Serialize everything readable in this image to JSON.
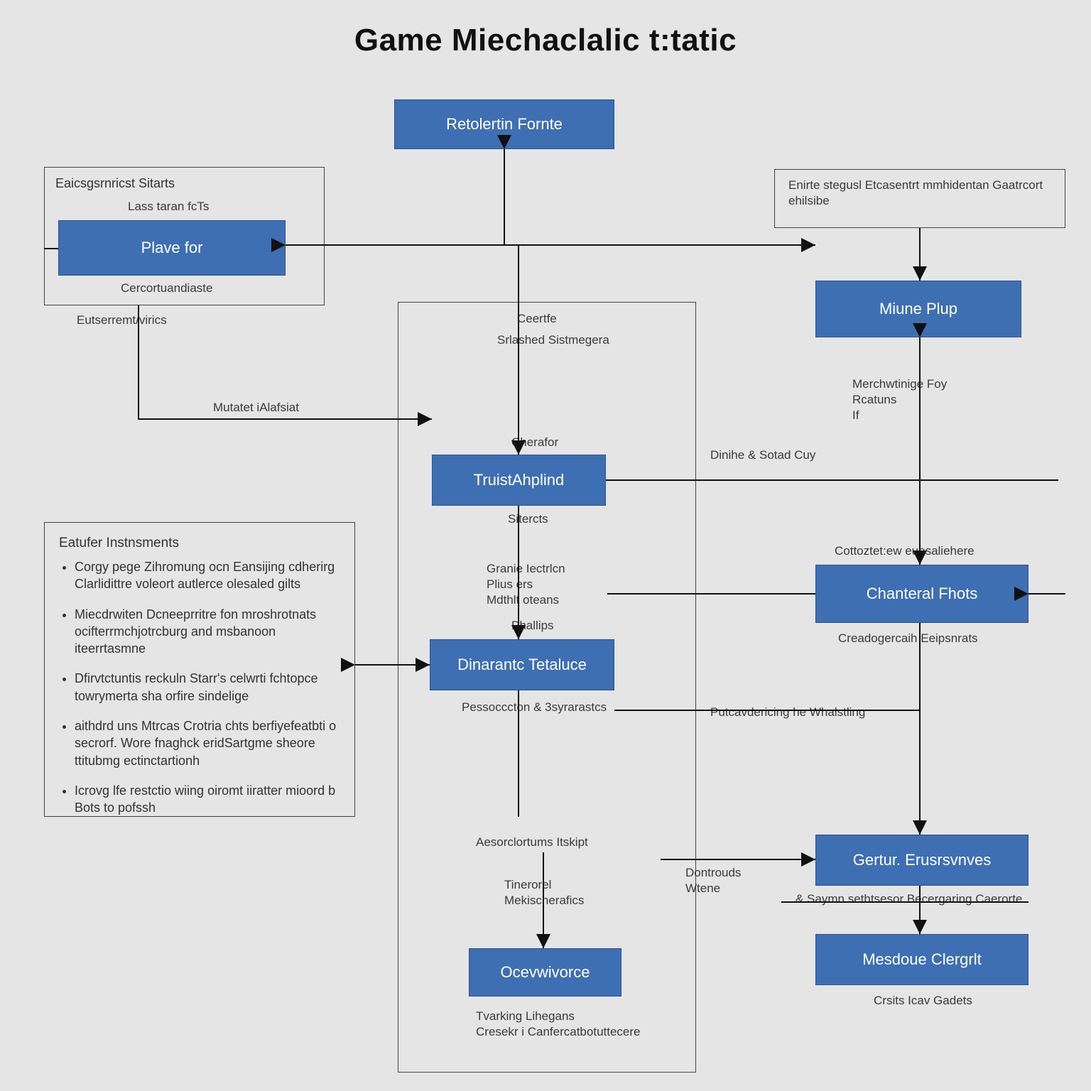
{
  "title": "Game Miechaclalic t:tatic",
  "blocks": {
    "top": "Retolertin Fornte",
    "player": "Plave for",
    "truist": "TruistAhplind",
    "dinamic": "Dinarantc Tetaluce",
    "miune": "Miune Plup",
    "chantral": "Chanteral Fhots",
    "gertur": "Gertur. Erusrsvnves",
    "mesdoue": "Mesdoue Clergrlt",
    "ocvw": "Ocevwivorce"
  },
  "containers": {
    "stats_title": "Eaicsgsrnricst Sitarts",
    "stats_sub": "Lass taran fcTs",
    "stats_under1": "Cercortuandiaste",
    "stats_under2": "Eutserremt/virics",
    "right_desc": "Enirte stegusl Etcasentrt mmhidentan Gaatrcort ehilsibe"
  },
  "labels": {
    "mutatet": "Mutatet iAlafsiat",
    "ceerte": "Ceertfe",
    "srlashed": "Srlashed Sistmegera",
    "cherafor": "Cherafor",
    "sitercts": "Sitercts",
    "granielection": "Granie Iectrlcn\nPlius ers\nMdthlt oteans",
    "phallips": "Phallips",
    "pessocccton": "Pessocccton & 3syrarastcs",
    "merchwtinige": "Merchwtinige Foy\nRcatuns\nIf",
    "dinihe": "Dinihe & Sotad Cuy",
    "cottoztor": "Cottoztet:ew euesaliehere",
    "creadoger": "Creadogercaih Eeipsnrats",
    "putcavericing": "Putcavdericing he Whalstling",
    "aesorclortums": "Aesorclortums Itskipt",
    "tinerorel": "Tinerorel\nMekischerafics",
    "dontrouds": "Dontrouds\nWtene",
    "sagmn": "& Saymn sethtsesor Becergaring Caerorte",
    "tvarking": "Tvarking Lihegans\nCresekr i Canfercatbotuttecere",
    "crsits": "Crsits Icav Gadets"
  },
  "notes": {
    "title": "Eatufer Instnsments",
    "items": [
      "Corgy pege Zihromung ocn Eansijing cdherirg Clarlidittre voleort autlerce olesaled gilts",
      "Miecdrwiten Dcneeprritre fon mroshrotnats ocifterrmchjotrcburg and msbanoon iteerrtasmne",
      "Dfirvtctuntis reckuln Starr's celwrti fchtopce towrymerta sha orfire sindelige",
      "aithdrd uns Mtrcas Crotria chts berfiyefeatbti o secrorf. Wore fnaghck eridSartgme sheore ttitubmg ectinctartionh",
      "Icrovg lfe restctio wiing oiromt iiratter mioord b Bots to pofssh"
    ]
  }
}
